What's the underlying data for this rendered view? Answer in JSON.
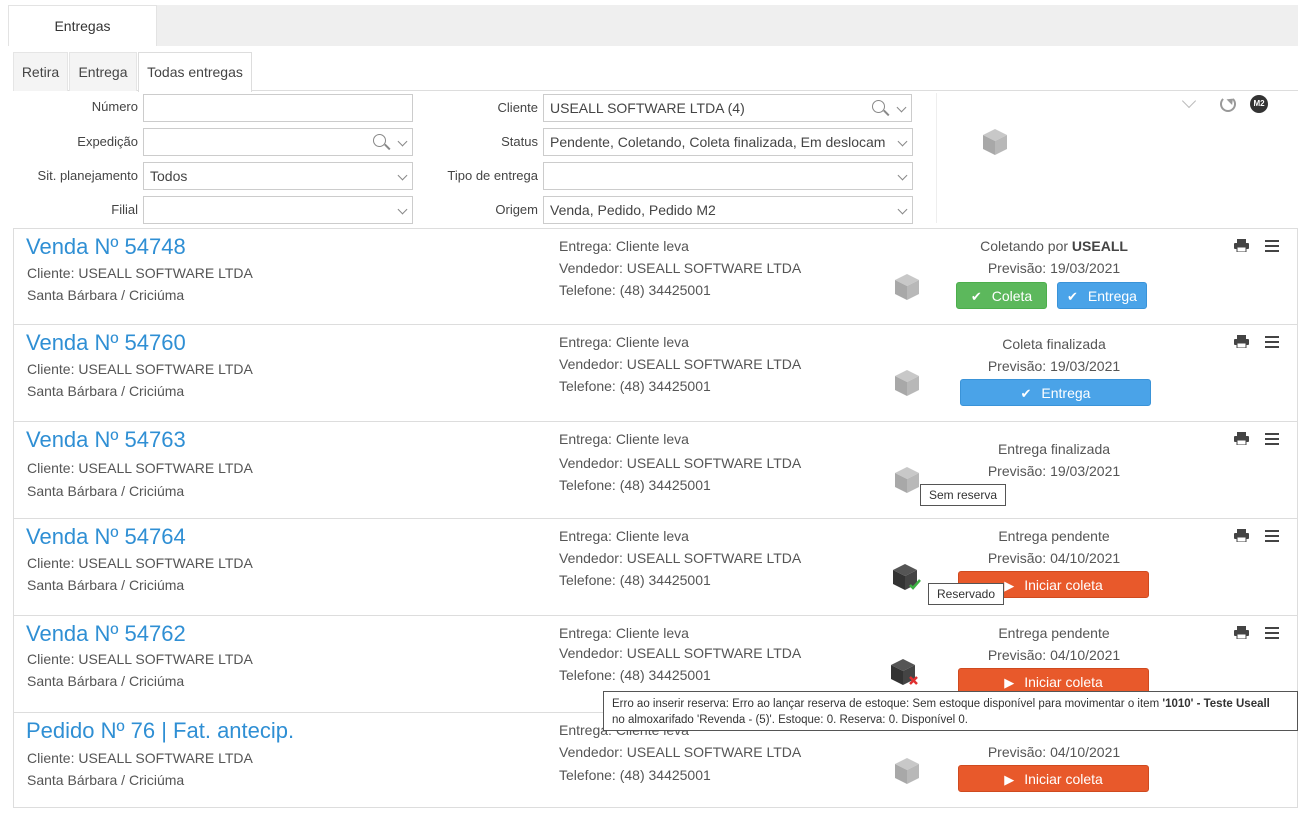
{
  "top_tab": {
    "label": "Entregas"
  },
  "sub_tabs": [
    {
      "label": "Retira"
    },
    {
      "label": "Entrega"
    },
    {
      "label": "Todas entregas"
    }
  ],
  "filters": {
    "numero": {
      "label": "Número",
      "value": ""
    },
    "expedicao": {
      "label": "Expedição",
      "value": ""
    },
    "sit_planejamento": {
      "label": "Sit. planejamento",
      "value": "Todos"
    },
    "filial": {
      "label": "Filial",
      "value": ""
    },
    "cliente": {
      "label": "Cliente",
      "value": "USEALL SOFTWARE LTDA (4)"
    },
    "status": {
      "label": "Status",
      "value": "Pendente, Coletando, Coleta finalizada, Em deslocamento"
    },
    "tipo_entrega": {
      "label": "Tipo de entrega",
      "value": ""
    },
    "origem": {
      "label": "Origem",
      "value": "Venda, Pedido, Pedido M2"
    }
  },
  "tools": {
    "m2_label": "M2"
  },
  "colors": {
    "title_blue": "#2f8fd4",
    "green": "#5cb85c",
    "blue": "#4aa3e8",
    "orange": "#e8592b"
  },
  "cards": [
    {
      "title": "Venda Nº 54748",
      "cliente": "Cliente: USEALL SOFTWARE LTDA",
      "local": "Santa Bárbara / Criciúma",
      "entrega": "Entrega: Cliente leva",
      "vendedor": "Vendedor:  USEALL SOFTWARE LTDA",
      "telefone": "Telefone: (48) 34425001",
      "status_prefix": "Coletando por ",
      "status_bold": "USEALL",
      "previsao": "Previsão: 19/03/2021",
      "buttons": [
        {
          "label": "Coleta"
        },
        {
          "label": "Entrega"
        }
      ]
    },
    {
      "title": "Venda Nº 54760",
      "cliente": "Cliente: USEALL SOFTWARE LTDA",
      "local": "Santa Bárbara / Criciúma",
      "entrega": "Entrega: Cliente leva",
      "vendedor": "Vendedor:  USEALL SOFTWARE LTDA",
      "telefone": "Telefone: (48) 34425001",
      "status": "Coleta finalizada",
      "previsao": "Previsão: 19/03/2021",
      "buttons": [
        {
          "label": "Entrega"
        }
      ]
    },
    {
      "title": "Venda Nº 54763",
      "cliente": "Cliente: USEALL SOFTWARE LTDA",
      "local": "Santa Bárbara / Criciúma",
      "entrega": "Entrega: Cliente leva",
      "vendedor": "Vendedor:  USEALL SOFTWARE LTDA",
      "telefone": "Telefone: (48) 34425001",
      "status": "Entrega finalizada",
      "previsao": "Previsão: 19/03/2021",
      "tooltip": "Sem reserva"
    },
    {
      "title": "Venda Nº 54764",
      "cliente": "Cliente: USEALL SOFTWARE LTDA",
      "local": "Santa Bárbara / Criciúma",
      "entrega": "Entrega: Cliente leva",
      "vendedor": "Vendedor:  USEALL SOFTWARE LTDA",
      "telefone": "Telefone: (48) 34425001",
      "status": "Entrega pendente",
      "previsao": "Previsão: 04/10/2021",
      "buttons": [
        {
          "label": "Iniciar coleta"
        }
      ],
      "tooltip": "Reservado"
    },
    {
      "title": "Venda Nº 54762",
      "cliente": "Cliente: USEALL SOFTWARE LTDA",
      "local": "Santa Bárbara / Criciúma",
      "entrega": "Entrega: Cliente leva",
      "vendedor": "Vendedor:  USEALL SOFTWARE LTDA",
      "telefone": "Telefone: (48) 34425001",
      "status": "Entrega pendente",
      "previsao": "Previsão: 04/10/2021",
      "buttons": [
        {
          "label": "Iniciar coleta"
        }
      ]
    },
    {
      "title": "Pedido Nº 76 | Fat. antecip.",
      "cliente": "Cliente: USEALL SOFTWARE LTDA",
      "local": "Santa Bárbara / Criciúma",
      "entrega": "Entrega: Cliente leva",
      "vendedor": "Vendedor:  USEALL SOFTWARE LTDA",
      "telefone": "Telefone: (48) 34425001",
      "previsao": "Previsão: 04/10/2021",
      "buttons": [
        {
          "label": "Iniciar coleta"
        }
      ]
    }
  ],
  "error_tooltip": {
    "part1": "Erro ao inserir reserva: Erro ao lançar reserva de estoque: Sem estoque disponível para movimentar o item ",
    "bold": "'1010' - Teste Useall",
    "part2": "no almoxarifado 'Revenda - (5)'. Estoque: 0. Reserva: 0. Disponível 0."
  }
}
